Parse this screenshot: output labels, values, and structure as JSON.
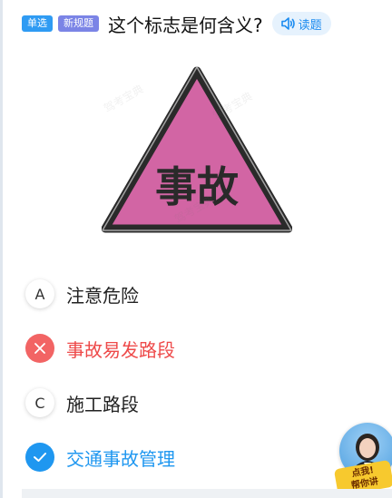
{
  "header": {
    "tag_single": "单选",
    "tag_new": "新规题",
    "question": "这个标志是何含义?",
    "read_label": "读题"
  },
  "sign": {
    "text": "事故",
    "fill_color": "#d265a4",
    "border_color": "#2a2a2a"
  },
  "watermark": "驾考宝典",
  "options": [
    {
      "letter": "A",
      "text": "注意危险",
      "state": "normal"
    },
    {
      "letter": "✕",
      "text": "事故易发路段",
      "state": "wrong"
    },
    {
      "letter": "C",
      "text": "施工路段",
      "state": "normal"
    },
    {
      "letter": "✓",
      "text": "交通事故管理",
      "state": "correct"
    }
  ],
  "helper": {
    "label_line1": "点我!",
    "label_line2": "帮你讲"
  },
  "colors": {
    "accent_blue": "#1f97f0",
    "wrong_red": "#f26464"
  }
}
